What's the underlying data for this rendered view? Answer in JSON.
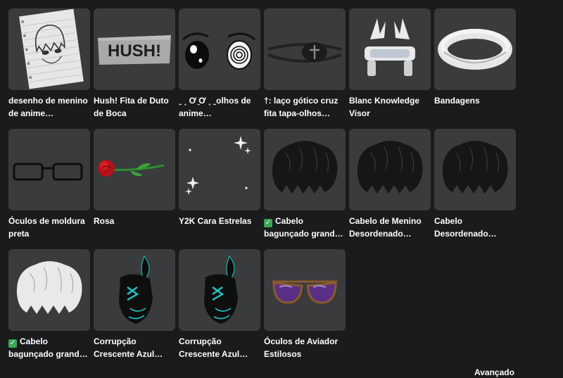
{
  "items": [
    {
      "name": "desenho de menino de anime…",
      "icon": "sketch-paper-icon",
      "checked": false
    },
    {
      "name": "Hush! Fita de Duto de Boca",
      "icon": "duct-tape-icon",
      "checked": false
    },
    {
      "name": "˷ ˳ Ơ ̫Ơ ˳ ˷olhos de anime…",
      "icon": "anime-eyes-icon",
      "checked": false
    },
    {
      "name": "†: laço gótico cruz fita tapa-olhos…",
      "icon": "gothic-eyepatch-icon",
      "checked": false
    },
    {
      "name": "Blanc Knowledge Visor",
      "icon": "visor-icon",
      "checked": false
    },
    {
      "name": "Bandagens",
      "icon": "bandage-icon",
      "checked": false
    },
    {
      "name": "Óculos de moldura preta",
      "icon": "black-glasses-icon",
      "checked": false
    },
    {
      "name": "Rosa",
      "icon": "rose-icon",
      "checked": false
    },
    {
      "name": "Y2K Cara Estrelas",
      "icon": "stars-icon",
      "checked": false
    },
    {
      "name": "Cabelo bagunçado grand…",
      "icon": "black-hair-icon",
      "checked": true
    },
    {
      "name": "Cabelo de Menino Desordenado…",
      "icon": "black-hair-icon",
      "checked": false
    },
    {
      "name": "Cabelo Desordenado…",
      "icon": "black-hair-icon",
      "checked": false
    },
    {
      "name": "Cabelo bagunçado grand…",
      "icon": "white-hair-icon",
      "checked": true
    },
    {
      "name": "Corrupção Crescente Azul…",
      "icon": "corruption-icon",
      "checked": false
    },
    {
      "name": "Corrupção Crescente Azul…",
      "icon": "corruption-icon",
      "checked": false
    },
    {
      "name": "Óculos de Aviador Estilosos",
      "icon": "aviator-glasses-icon",
      "checked": false
    }
  ],
  "advanced_label": "Avançado",
  "colors": {
    "background": "#191b1d",
    "tile": "#393b3d",
    "check": "#3aa757"
  }
}
